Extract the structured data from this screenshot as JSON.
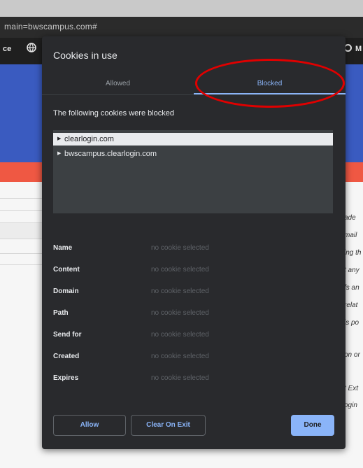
{
  "browser": {
    "address_text": "main=bwscampus.com#",
    "toolbar_left_text": "ce",
    "toolbar_right_text": "M"
  },
  "background_page": {
    "side_text": [
      "ade",
      "mail",
      "ing th",
      "t any",
      "fs an",
      "relat",
      "is po",
      "on or",
      "t Ext",
      "ogin"
    ]
  },
  "dialog": {
    "title": "Cookies in use",
    "tabs": [
      {
        "label": "Allowed",
        "selected": false
      },
      {
        "label": "Blocked",
        "selected": true
      }
    ],
    "description": "The following cookies were blocked",
    "tree": [
      {
        "label": "clearlogin.com",
        "selected": true
      },
      {
        "label": "bwscampus.clearlogin.com",
        "selected": false
      }
    ],
    "fields": [
      {
        "label": "Name",
        "value": "no cookie selected"
      },
      {
        "label": "Content",
        "value": "no cookie selected"
      },
      {
        "label": "Domain",
        "value": "no cookie selected"
      },
      {
        "label": "Path",
        "value": "no cookie selected"
      },
      {
        "label": "Send for",
        "value": "no cookie selected"
      },
      {
        "label": "Created",
        "value": "no cookie selected"
      },
      {
        "label": "Expires",
        "value": "no cookie selected"
      }
    ],
    "buttons": {
      "allow": "Allow",
      "clear_on_exit": "Clear On Exit",
      "done": "Done"
    }
  },
  "colors": {
    "accent": "#8ab4f8",
    "dialog_bg": "#292a2d",
    "annotation": "#e00000",
    "banner_blue": "#3a5bc0",
    "banner_red": "#ef5843"
  }
}
